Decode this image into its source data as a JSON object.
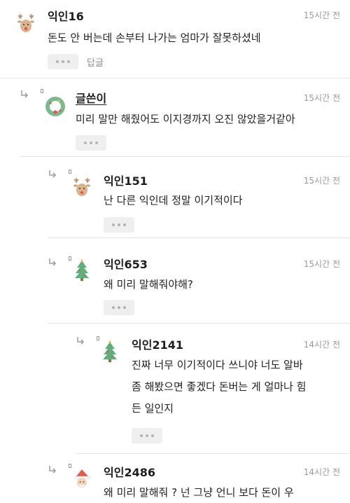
{
  "comments": [
    {
      "author": "익인16",
      "time": "15시간 전",
      "lines": [
        "돈도 안 버는데 손부터 나가는 엄마가 잘못하셨네"
      ],
      "reply_label": "답글",
      "avatar_icon": "reindeer-icon"
    },
    {
      "author": "글쓴이",
      "time": "15시간 전",
      "lines": [
        "미리 말만 해줬어도 이지경까지 오진 않았을거같아"
      ],
      "avatar_icon": "wreath-icon"
    },
    {
      "author": "익인151",
      "time": "15시간 전",
      "lines": [
        "난 다른 익인데 정말 이기적이다"
      ],
      "avatar_icon": "reindeer-icon"
    },
    {
      "author": "익인653",
      "time": "15시간 전",
      "lines": [
        "왜 미리 말해줘야해?"
      ],
      "avatar_icon": "christmas-tree-icon"
    },
    {
      "author": "익인2141",
      "time": "14시간 전",
      "lines": [
        "진짜 너무 이기적이다 쓰니야 너도 알바",
        "좀 해봤으면 좋겠다 돈버는 게 얼마나 힘",
        "든 일인지"
      ],
      "avatar_icon": "christmas-tree-icon"
    },
    {
      "author": "익인2486",
      "time": "14시간 전",
      "lines": [
        "왜 미리 말해줘 ? 넌 그냥 언니 보다 돈이 우"
      ],
      "avatar_icon": "santa-icon"
    }
  ],
  "colors": {
    "button_bg": "#efefef",
    "dots": "#b3b3b3",
    "time": "#9a9a9a"
  }
}
